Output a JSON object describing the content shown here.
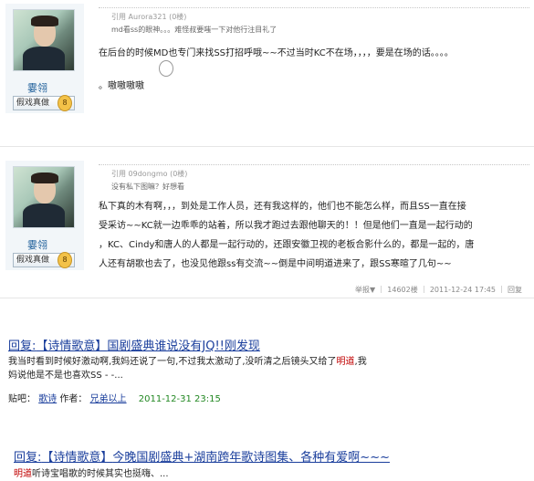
{
  "post1": {
    "username": "霎翎",
    "rank_label": "假戏真做",
    "rank_badge": "8",
    "quote_head": "引用 Aurora321 (0楼)",
    "quote_text": "md看ss的眼神。。。难怪叔要嗤一下对他行注目礼了",
    "line1": "在后台的时候MD也专门来找SS打招呼哦~~不过当时KC不在场，，，，要是在场的话。。。。",
    "line2": "。嗷嗷嗷嗷"
  },
  "post2": {
    "username": "霎翎",
    "rank_label": "假戏真做",
    "rank_badge": "8",
    "quote_head": "引用 09dongmo (0楼)",
    "quote_text": "没有私下图嘛？好想看",
    "lines": [
      "私下真的木有啊，，，到处是工作人员，还有我这样的，他们也不能怎么样，而且SS一直在接",
      "受采访~~KC就一边乖乖的站着，所以我才跑过去跟他聊天的！！但是他们一直是一起行动的",
      "，KC、Cindy和唐人的人都是一起行动的，还跟安徽卫视的老板合影什么的，都是一起的，唐",
      "人还有胡歌也去了，也没见他跟ss有交流~~倒是中间明道进来了，跟SS寒暄了几句~~"
    ],
    "meta": "举报▼ ｜ 14602楼 ｜ 2011-12-24 17:45 ｜ 回复"
  },
  "result1": {
    "title_prefix": "回复:",
    "title_bracket": "【诗情歌意】",
    "title_rest": "国剧盛典谁说没有JQ!!刚发现",
    "body_line1_a": "我当时看到时候好激动啊,我妈还说了一句,不过我太激动了,没听清之后镜头又给了",
    "body_line1_hl": "明道",
    "body_line1_b": ",我",
    "body_line2": "妈说他是不是也喜欢SS - -...",
    "meta_label": "贴吧：",
    "meta_bar": "歌诗",
    "meta_author_label": "作者：",
    "meta_author": "兄弟以上",
    "meta_date": "2011-12-31 23:15"
  },
  "result2": {
    "title_prefix": "回复:",
    "title_bracket": "【诗情歌意】",
    "title_rest": "今晚国剧盛典+湖南跨年歌诗图集、各种有爱啊~~~",
    "body_hl": "明道",
    "body_rest": "听诗宝唱歌的时候其实也挺嗨、..."
  }
}
